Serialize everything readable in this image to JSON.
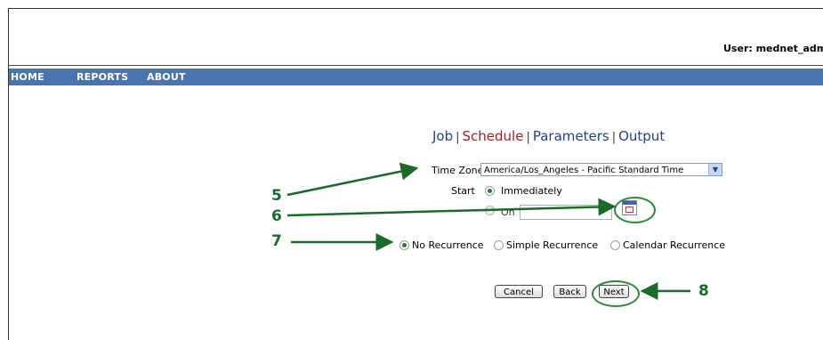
{
  "header": {
    "user_label": "User: mednet_admi"
  },
  "nav": {
    "items": [
      "HOME",
      "REPORTS",
      "ABOUT"
    ]
  },
  "steps": {
    "job": "Job",
    "separator": "|",
    "schedule": "Schedule",
    "parameters": "Parameters",
    "output": "Output",
    "active": "Schedule"
  },
  "form": {
    "time_zone_label": "Time Zone",
    "time_zone_value": "America/Los_Angeles - Pacific Standard Time",
    "start_label": "Start",
    "immediately_label": "Immediately",
    "on_label": "On",
    "date_value": "",
    "recurrence": {
      "options": [
        "No Recurrence",
        "Simple Recurrence",
        "Calendar Recurrence"
      ],
      "selected": "No Recurrence"
    },
    "start_selected": "Immediately"
  },
  "buttons": {
    "cancel": "Cancel",
    "back": "Back",
    "next": "Next"
  },
  "annotations": {
    "n5": "5",
    "n6": "6",
    "n7": "7",
    "n8": "8",
    "color": "#1b6a2a"
  },
  "colors": {
    "navbar": "#4a74b0",
    "active_step": "#a11f1f",
    "step_link": "#24418c"
  }
}
